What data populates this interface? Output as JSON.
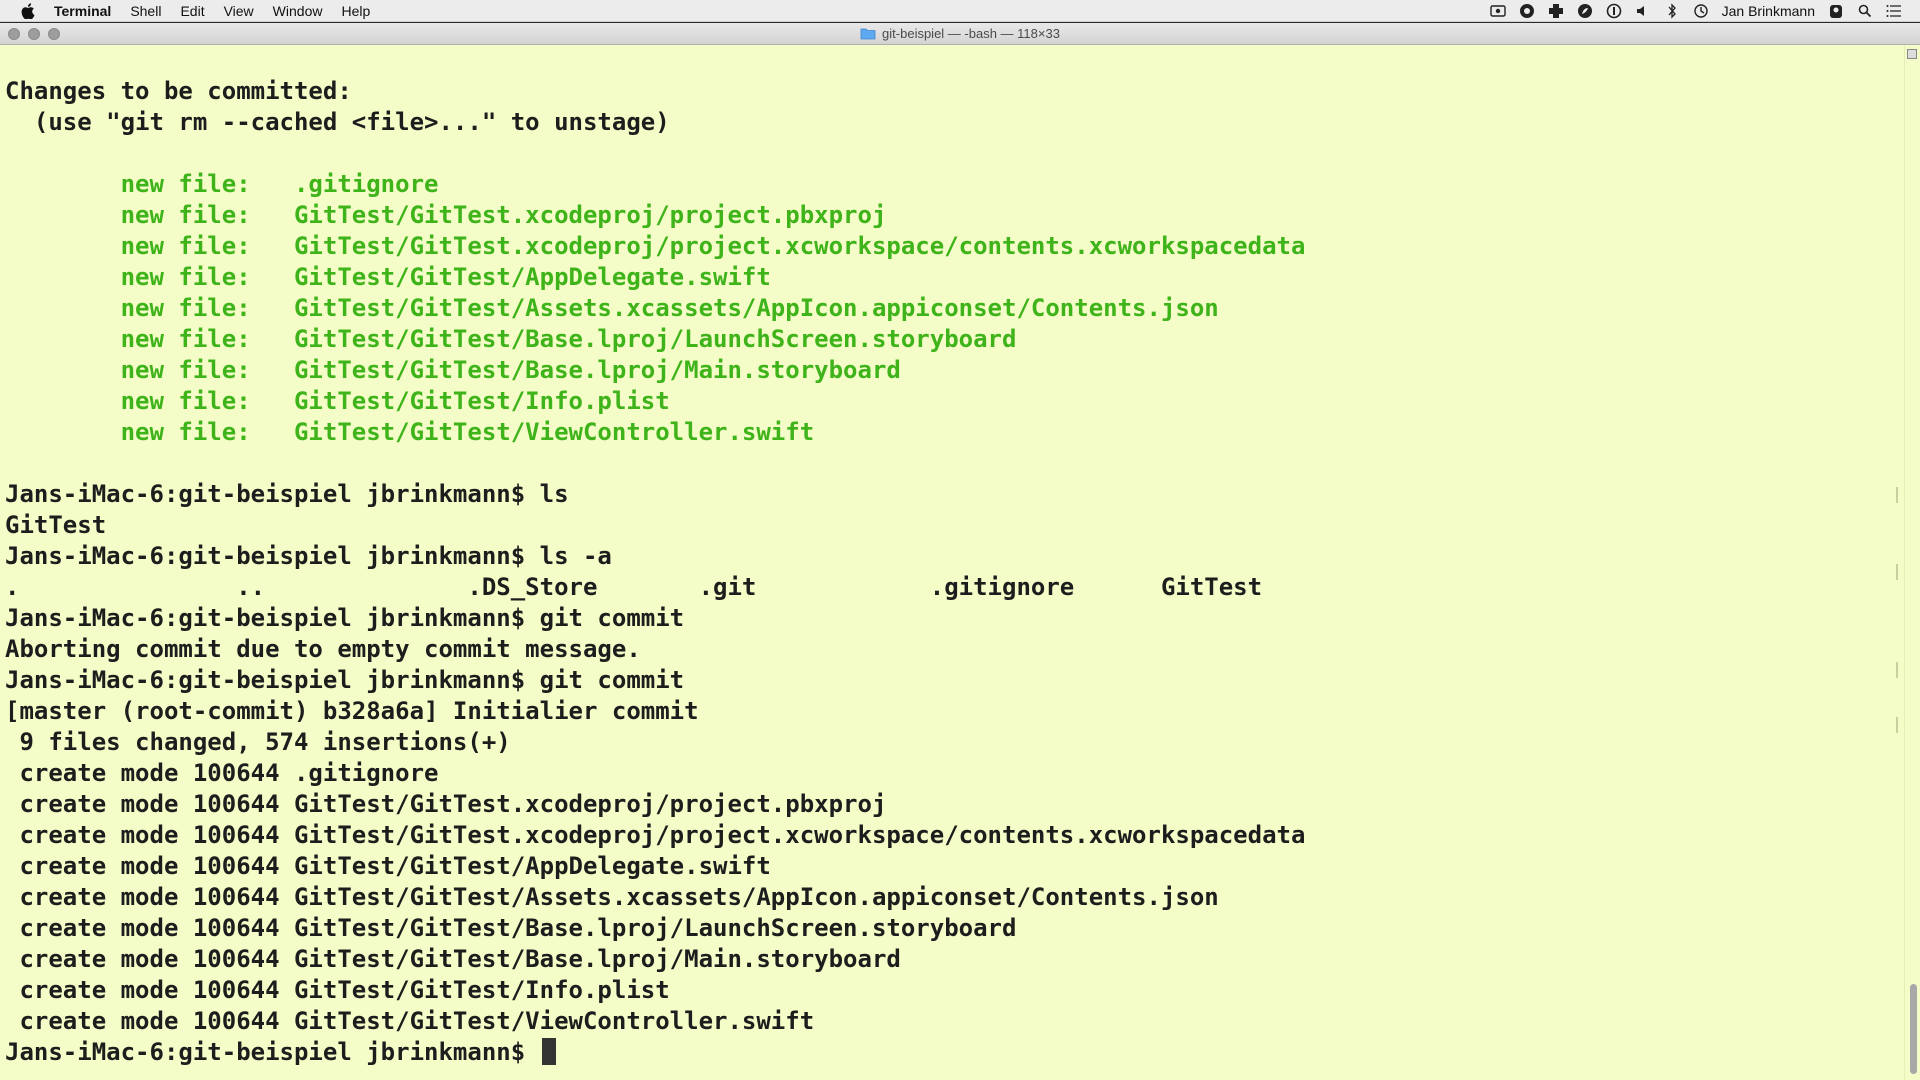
{
  "menubar": {
    "app_name": "Terminal",
    "items": [
      "Shell",
      "Edit",
      "View",
      "Window",
      "Help"
    ],
    "user_name": "Jan Brinkmann",
    "status_icons": [
      "screen-record-icon",
      "camera-icon",
      "plus-icon",
      "leaf-icon",
      "info-icon",
      "volume-icon",
      "bluetooth-icon",
      "time-machine-icon",
      "user-icon",
      "spotlight-search-icon",
      "notification-center-icon"
    ]
  },
  "window": {
    "title": "git-beispiel — -bash — 118×33"
  },
  "terminal": {
    "lines": [
      {
        "text": "Changes to be committed:",
        "style": "normal"
      },
      {
        "text": "  (use \"git rm --cached <file>...\" to unstage)",
        "style": "normal"
      },
      {
        "text": "",
        "style": "normal"
      },
      {
        "text": "        new file:   .gitignore",
        "style": "green"
      },
      {
        "text": "        new file:   GitTest/GitTest.xcodeproj/project.pbxproj",
        "style": "green"
      },
      {
        "text": "        new file:   GitTest/GitTest.xcodeproj/project.xcworkspace/contents.xcworkspacedata",
        "style": "green"
      },
      {
        "text": "        new file:   GitTest/GitTest/AppDelegate.swift",
        "style": "green"
      },
      {
        "text": "        new file:   GitTest/GitTest/Assets.xcassets/AppIcon.appiconset/Contents.json",
        "style": "green"
      },
      {
        "text": "        new file:   GitTest/GitTest/Base.lproj/LaunchScreen.storyboard",
        "style": "green"
      },
      {
        "text": "        new file:   GitTest/GitTest/Base.lproj/Main.storyboard",
        "style": "green"
      },
      {
        "text": "        new file:   GitTest/GitTest/Info.plist",
        "style": "green"
      },
      {
        "text": "        new file:   GitTest/GitTest/ViewController.swift",
        "style": "green"
      },
      {
        "text": "",
        "style": "normal"
      },
      {
        "text": "Jans-iMac-6:git-beispiel jbrinkmann$ ls",
        "style": "normal"
      },
      {
        "text": "GitTest",
        "style": "normal"
      },
      {
        "text": "Jans-iMac-6:git-beispiel jbrinkmann$ ls -a",
        "style": "normal"
      },
      {
        "text": ".               ..              .DS_Store       .git            .gitignore      GitTest",
        "style": "normal"
      },
      {
        "text": "Jans-iMac-6:git-beispiel jbrinkmann$ git commit",
        "style": "normal"
      },
      {
        "text": "Aborting commit due to empty commit message.",
        "style": "normal"
      },
      {
        "text": "Jans-iMac-6:git-beispiel jbrinkmann$ git commit",
        "style": "normal"
      },
      {
        "text": "[master (root-commit) b328a6a] Initialier commit",
        "style": "normal"
      },
      {
        "text": " 9 files changed, 574 insertions(+)",
        "style": "normal"
      },
      {
        "text": " create mode 100644 .gitignore",
        "style": "normal"
      },
      {
        "text": " create mode 100644 GitTest/GitTest.xcodeproj/project.pbxproj",
        "style": "normal"
      },
      {
        "text": " create mode 100644 GitTest/GitTest.xcodeproj/project.xcworkspace/contents.xcworkspacedata",
        "style": "normal"
      },
      {
        "text": " create mode 100644 GitTest/GitTest/AppDelegate.swift",
        "style": "normal"
      },
      {
        "text": " create mode 100644 GitTest/GitTest/Assets.xcassets/AppIcon.appiconset/Contents.json",
        "style": "normal"
      },
      {
        "text": " create mode 100644 GitTest/GitTest/Base.lproj/LaunchScreen.storyboard",
        "style": "normal"
      },
      {
        "text": " create mode 100644 GitTest/GitTest/Base.lproj/Main.storyboard",
        "style": "normal"
      },
      {
        "text": " create mode 100644 GitTest/GitTest/Info.plist",
        "style": "normal"
      },
      {
        "text": " create mode 100644 GitTest/GitTest/ViewController.swift",
        "style": "normal"
      },
      {
        "text": "Jans-iMac-6:git-beispiel jbrinkmann$ ",
        "style": "prompt"
      }
    ]
  },
  "colors": {
    "terminal_background": "#f4fcc7",
    "terminal_text": "#1d1d1d",
    "git_status_green": "#3fb31a"
  }
}
